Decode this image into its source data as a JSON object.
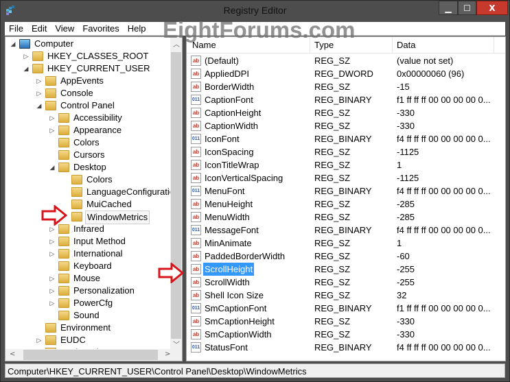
{
  "window": {
    "title": "Registry Editor",
    "minimize": "▁",
    "maximize": "☐",
    "close": "X"
  },
  "menu": [
    {
      "label": "File",
      "key": "F"
    },
    {
      "label": "Edit",
      "key": "E"
    },
    {
      "label": "View",
      "key": "V"
    },
    {
      "label": "Favorites",
      "key": "a"
    },
    {
      "label": "Help",
      "key": "H"
    }
  ],
  "watermark": "EightForums.com",
  "tree": [
    {
      "label": "Computer",
      "level": 0,
      "state": "expanded",
      "icon": "computer-icon"
    },
    {
      "label": "HKEY_CLASSES_ROOT",
      "level": 1,
      "state": "collapsed"
    },
    {
      "label": "HKEY_CURRENT_USER",
      "level": 1,
      "state": "expanded"
    },
    {
      "label": "AppEvents",
      "level": 2,
      "state": "collapsed"
    },
    {
      "label": "Console",
      "level": 2,
      "state": "collapsed"
    },
    {
      "label": "Control Panel",
      "level": 2,
      "state": "expanded"
    },
    {
      "label": "Accessibility",
      "level": 3,
      "state": "collapsed"
    },
    {
      "label": "Appearance",
      "level": 3,
      "state": "collapsed"
    },
    {
      "label": "Colors",
      "level": 3,
      "state": "none"
    },
    {
      "label": "Cursors",
      "level": 3,
      "state": "none"
    },
    {
      "label": "Desktop",
      "level": 3,
      "state": "expanded"
    },
    {
      "label": "Colors",
      "level": 4,
      "state": "none"
    },
    {
      "label": "LanguageConfiguration",
      "level": 4,
      "state": "none"
    },
    {
      "label": "MuiCached",
      "level": 4,
      "state": "none"
    },
    {
      "label": "WindowMetrics",
      "level": 4,
      "state": "none",
      "selected": true
    },
    {
      "label": "Infrared",
      "level": 3,
      "state": "collapsed"
    },
    {
      "label": "Input Method",
      "level": 3,
      "state": "collapsed"
    },
    {
      "label": "International",
      "level": 3,
      "state": "collapsed"
    },
    {
      "label": "Keyboard",
      "level": 3,
      "state": "none"
    },
    {
      "label": "Mouse",
      "level": 3,
      "state": "collapsed"
    },
    {
      "label": "Personalization",
      "level": 3,
      "state": "collapsed"
    },
    {
      "label": "PowerCfg",
      "level": 3,
      "state": "collapsed"
    },
    {
      "label": "Sound",
      "level": 3,
      "state": "none"
    },
    {
      "label": "Environment",
      "level": 2,
      "state": "none"
    },
    {
      "label": "EUDC",
      "level": 2,
      "state": "collapsed"
    },
    {
      "label": "Keyboard Layout",
      "level": 2,
      "state": "collapsed"
    }
  ],
  "list": {
    "columns": [
      "Name",
      "Type",
      "Data"
    ],
    "rows": [
      {
        "name": "(Default)",
        "type": "REG_SZ",
        "data": "(value not set)"
      },
      {
        "name": "AppliedDPI",
        "type": "REG_DWORD",
        "data": "0x00000060 (96)"
      },
      {
        "name": "BorderWidth",
        "type": "REG_SZ",
        "data": "-15"
      },
      {
        "name": "CaptionFont",
        "type": "REG_BINARY",
        "data": "f1 ff ff ff 00 00 00 00 0..."
      },
      {
        "name": "CaptionHeight",
        "type": "REG_SZ",
        "data": "-330"
      },
      {
        "name": "CaptionWidth",
        "type": "REG_SZ",
        "data": "-330"
      },
      {
        "name": "IconFont",
        "type": "REG_BINARY",
        "data": "f4 ff ff ff 00 00 00 00 0..."
      },
      {
        "name": "IconSpacing",
        "type": "REG_SZ",
        "data": "-1125"
      },
      {
        "name": "IconTitleWrap",
        "type": "REG_SZ",
        "data": "1"
      },
      {
        "name": "IconVerticalSpacing",
        "type": "REG_SZ",
        "data": "-1125"
      },
      {
        "name": "MenuFont",
        "type": "REG_BINARY",
        "data": "f4 ff ff ff 00 00 00 00 0..."
      },
      {
        "name": "MenuHeight",
        "type": "REG_SZ",
        "data": "-285"
      },
      {
        "name": "MenuWidth",
        "type": "REG_SZ",
        "data": "-285"
      },
      {
        "name": "MessageFont",
        "type": "REG_BINARY",
        "data": "f4 ff ff ff 00 00 00 00 0..."
      },
      {
        "name": "MinAnimate",
        "type": "REG_SZ",
        "data": "1"
      },
      {
        "name": "PaddedBorderWidth",
        "type": "REG_SZ",
        "data": "-60"
      },
      {
        "name": "ScrollHeight",
        "type": "REG_SZ",
        "data": "-255",
        "selected": true
      },
      {
        "name": "ScrollWidth",
        "type": "REG_SZ",
        "data": "-255"
      },
      {
        "name": "Shell Icon Size",
        "type": "REG_SZ",
        "data": "32"
      },
      {
        "name": "SmCaptionFont",
        "type": "REG_BINARY",
        "data": "f1 ff ff ff 00 00 00 00 0..."
      },
      {
        "name": "SmCaptionHeight",
        "type": "REG_SZ",
        "data": "-330"
      },
      {
        "name": "SmCaptionWidth",
        "type": "REG_SZ",
        "data": "-330"
      },
      {
        "name": "StatusFont",
        "type": "REG_BINARY",
        "data": "f4 ff ff ff 00 00 00 00 0..."
      }
    ],
    "icon_text": {
      "sz": "ab",
      "bin": "011"
    }
  },
  "status": {
    "path": "Computer\\HKEY_CURRENT_USER\\Control Panel\\Desktop\\WindowMetrics"
  },
  "colors": {
    "selection": "#3399ff",
    "arrow": "#d8141b",
    "close": "#c7392d"
  }
}
